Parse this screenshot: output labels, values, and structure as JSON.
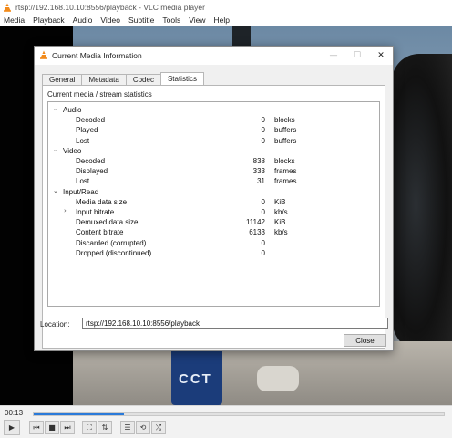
{
  "app": {
    "title": "rtsp://192.168.10.10:8556/playback - VLC media player"
  },
  "menu": [
    "Media",
    "Playback",
    "Audio",
    "Video",
    "Subtitle",
    "Tools",
    "View",
    "Help"
  ],
  "video_overlay_text": "CCT",
  "player": {
    "time": "00:13",
    "progress_fraction": 0.22,
    "buttons": {
      "play": "▶",
      "prev": "⏮",
      "stop": "■",
      "next": "⏭",
      "fullscreen": "⛶",
      "extended": "⇅",
      "playlist": "☰",
      "loop": "⟲",
      "random": "⤮"
    }
  },
  "dialog": {
    "title": "Current Media Information",
    "window_buttons": {
      "minimize": "—",
      "maximize": "☐",
      "close": "✕"
    },
    "tabs": [
      "General",
      "Metadata",
      "Codec",
      "Statistics"
    ],
    "active_tab": "Statistics",
    "caption": "Current media / stream statistics",
    "stats": [
      {
        "type": "category",
        "label": "Audio",
        "arrow": "⌄"
      },
      {
        "type": "item",
        "label": "Decoded",
        "value": "0",
        "unit": "blocks"
      },
      {
        "type": "item",
        "label": "Played",
        "value": "0",
        "unit": "buffers"
      },
      {
        "type": "item",
        "label": "Lost",
        "value": "0",
        "unit": "buffers"
      },
      {
        "type": "category",
        "label": "Video",
        "arrow": "⌄"
      },
      {
        "type": "item",
        "label": "Decoded",
        "value": "838",
        "unit": "blocks"
      },
      {
        "type": "item",
        "label": "Displayed",
        "value": "333",
        "unit": "frames"
      },
      {
        "type": "item",
        "label": "Lost",
        "value": "31",
        "unit": "frames"
      },
      {
        "type": "category",
        "label": "Input/Read",
        "arrow": "⌄"
      },
      {
        "type": "item",
        "label": "Media data size",
        "value": "0",
        "unit": "KiB"
      },
      {
        "type": "item",
        "label": "Input bitrate",
        "value": "0",
        "unit": "kb/s",
        "arrow": "›"
      },
      {
        "type": "item",
        "label": "Demuxed data size",
        "value": "11142",
        "unit": "KiB"
      },
      {
        "type": "item",
        "label": "Content bitrate",
        "value": "6133",
        "unit": "kb/s"
      },
      {
        "type": "item",
        "label": "Discarded (corrupted)",
        "value": "0",
        "unit": ""
      },
      {
        "type": "item",
        "label": "Dropped (discontinued)",
        "value": "0",
        "unit": ""
      }
    ],
    "location_label": "Location:",
    "location_value": "rtsp://192.168.10.10:8556/playback",
    "close_label": "Close"
  }
}
